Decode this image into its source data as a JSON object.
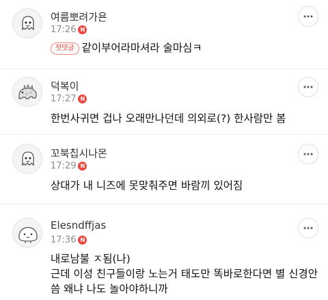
{
  "comments": [
    {
      "nickname": "여름뽀려가욘",
      "time": "17:26",
      "new_badge": "N",
      "first_badge": "첫댓글",
      "lines": [
        "같이부어라마셔라 술마심ㅋ"
      ]
    },
    {
      "nickname": "덕복이",
      "time": "17:27",
      "new_badge": "N",
      "lines": [
        "한번사귀면 겁나 오래만나던데 의외로(?) 한사람만 봄"
      ]
    },
    {
      "nickname": "꼬북칩시나몬",
      "time": "17:29",
      "new_badge": "N",
      "lines": [
        "상대가 내 니즈에 못맞춰주면 바람끼 있어짐"
      ]
    },
    {
      "nickname": "Elesndffjas",
      "time": "17:36",
      "new_badge": "N",
      "lines": [
        "내로남불 ㅈ됨(나)",
        "근데 이성 친구들이랑 노는거 태도만 똑바로한다면 별 신경안",
        "씀 왜냐 나도 놀아야하니까"
      ]
    }
  ],
  "more_icon": "more-horizontal-icon",
  "colors": {
    "new_badge": "#e8483f",
    "first_badge_border": "#f08a82",
    "divider": "#ececec"
  }
}
